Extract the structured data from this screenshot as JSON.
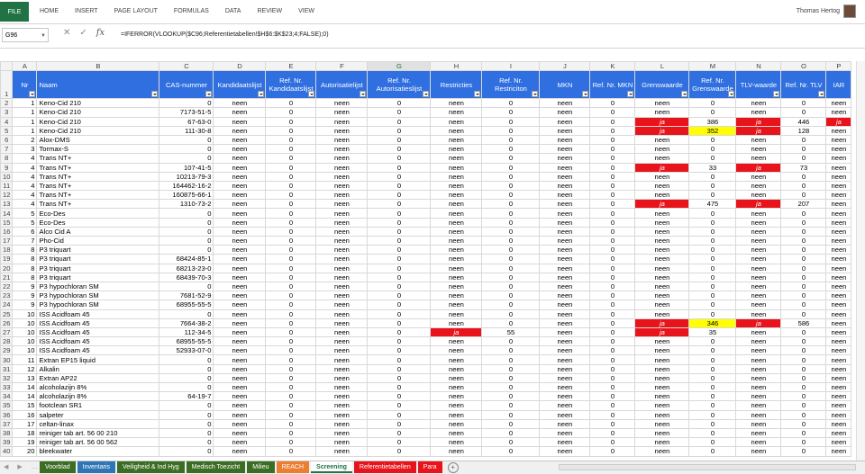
{
  "ribbon": {
    "file_label": "FILE",
    "tabs": [
      "HOME",
      "INSERT",
      "PAGE LAYOUT",
      "FORMULAS",
      "DATA",
      "REVIEW",
      "VIEW"
    ],
    "user_name": "Thomas Hertog"
  },
  "formula_bar": {
    "name_box": "G96",
    "formula": "=IFERROR(VLOOKUP($C96;Referentietabellen!$H$6:$K$23;4;FALSE);0)"
  },
  "columns": [
    "A",
    "B",
    "C",
    "D",
    "E",
    "F",
    "G",
    "H",
    "I",
    "J",
    "K",
    "L",
    "M",
    "N",
    "O",
    "P"
  ],
  "selected_column": "G",
  "headers": [
    "Nr",
    "Naam",
    "CAS-nummer",
    "Kandidaatslijst",
    "Ref. Nr. Kandidaatslijst",
    "Autorisatielijst",
    "Ref. Nr. Autorisatieslijst",
    "Restricties",
    "Ref. Nr. Restriciton",
    "MKN",
    "Ref. Nr. MKN",
    "Grenswaarde",
    "Ref. Nr. Grenswaarde",
    "TLV-waarde",
    "Ref. Nr. TLV",
    "IAR"
  ],
  "rows": [
    [
      "2",
      "1",
      "Keno-Cid 210",
      "0",
      "neen",
      "0",
      "neen",
      "0",
      "neen",
      "0",
      "neen",
      "0",
      "neen",
      "0",
      "neen",
      "0",
      "neen"
    ],
    [
      "3",
      "1",
      "Keno-Cid 210",
      "7173-51-5",
      "neen",
      "0",
      "neen",
      "0",
      "neen",
      "0",
      "neen",
      "0",
      "neen",
      "0",
      "neen",
      "0",
      "neen"
    ],
    [
      "4",
      "1",
      "Keno-Cid 210",
      "67-63-0",
      "neen",
      "0",
      "neen",
      "0",
      "neen",
      "0",
      "neen",
      "0",
      "ja",
      "386",
      "ja",
      "446",
      "ja"
    ],
    [
      "5",
      "1",
      "Keno-Cid 210",
      "111-30-8",
      "neen",
      "0",
      "neen",
      "0",
      "neen",
      "0",
      "neen",
      "0",
      "ja",
      "352",
      "ja",
      "128",
      "neen"
    ],
    [
      "6",
      "2",
      "Alox-DMS",
      "0",
      "neen",
      "0",
      "neen",
      "0",
      "neen",
      "0",
      "neen",
      "0",
      "neen",
      "0",
      "neen",
      "0",
      "neen"
    ],
    [
      "7",
      "3",
      "Tormax-S",
      "0",
      "neen",
      "0",
      "neen",
      "0",
      "neen",
      "0",
      "neen",
      "0",
      "neen",
      "0",
      "neen",
      "0",
      "neen"
    ],
    [
      "8",
      "4",
      "Trans NT+",
      "0",
      "neen",
      "0",
      "neen",
      "0",
      "neen",
      "0",
      "neen",
      "0",
      "neen",
      "0",
      "neen",
      "0",
      "neen"
    ],
    [
      "9",
      "4",
      "Trans NT+",
      "107-41-5",
      "neen",
      "0",
      "neen",
      "0",
      "neen",
      "0",
      "neen",
      "0",
      "ja",
      "33",
      "ja",
      "73",
      "neen"
    ],
    [
      "10",
      "4",
      "Trans NT+",
      "10213-79-3",
      "neen",
      "0",
      "neen",
      "0",
      "neen",
      "0",
      "neen",
      "0",
      "neen",
      "0",
      "neen",
      "0",
      "neen"
    ],
    [
      "11",
      "4",
      "Trans NT+",
      "164462-16-2",
      "neen",
      "0",
      "neen",
      "0",
      "neen",
      "0",
      "neen",
      "0",
      "neen",
      "0",
      "neen",
      "0",
      "neen"
    ],
    [
      "12",
      "4",
      "Trans NT+",
      "160875-66-1",
      "neen",
      "0",
      "neen",
      "0",
      "neen",
      "0",
      "neen",
      "0",
      "neen",
      "0",
      "neen",
      "0",
      "neen"
    ],
    [
      "13",
      "4",
      "Trans NT+",
      "1310-73-2",
      "neen",
      "0",
      "neen",
      "0",
      "neen",
      "0",
      "neen",
      "0",
      "ja",
      "475",
      "ja",
      "207",
      "neen"
    ],
    [
      "14",
      "5",
      "Eco-Des",
      "0",
      "neen",
      "0",
      "neen",
      "0",
      "neen",
      "0",
      "neen",
      "0",
      "neen",
      "0",
      "neen",
      "0",
      "neen"
    ],
    [
      "15",
      "5",
      "Eco-Des",
      "0",
      "neen",
      "0",
      "neen",
      "0",
      "neen",
      "0",
      "neen",
      "0",
      "neen",
      "0",
      "neen",
      "0",
      "neen"
    ],
    [
      "16",
      "6",
      "Alco Cid A",
      "0",
      "neen",
      "0",
      "neen",
      "0",
      "neen",
      "0",
      "neen",
      "0",
      "neen",
      "0",
      "neen",
      "0",
      "neen"
    ],
    [
      "17",
      "7",
      "Pho-Cid",
      "0",
      "neen",
      "0",
      "neen",
      "0",
      "neen",
      "0",
      "neen",
      "0",
      "neen",
      "0",
      "neen",
      "0",
      "neen"
    ],
    [
      "18",
      "8",
      "P3 triquart",
      "0",
      "neen",
      "0",
      "neen",
      "0",
      "neen",
      "0",
      "neen",
      "0",
      "neen",
      "0",
      "neen",
      "0",
      "neen"
    ],
    [
      "19",
      "8",
      "P3 triquart",
      "68424-85-1",
      "neen",
      "0",
      "neen",
      "0",
      "neen",
      "0",
      "neen",
      "0",
      "neen",
      "0",
      "neen",
      "0",
      "neen"
    ],
    [
      "20",
      "8",
      "P3 triquart",
      "68213-23-0",
      "neen",
      "0",
      "neen",
      "0",
      "neen",
      "0",
      "neen",
      "0",
      "neen",
      "0",
      "neen",
      "0",
      "neen"
    ],
    [
      "21",
      "8",
      "P3 triquart",
      "68439-70-3",
      "neen",
      "0",
      "neen",
      "0",
      "neen",
      "0",
      "neen",
      "0",
      "neen",
      "0",
      "neen",
      "0",
      "neen"
    ],
    [
      "22",
      "9",
      "P3 hypochloran SM",
      "0",
      "neen",
      "0",
      "neen",
      "0",
      "neen",
      "0",
      "neen",
      "0",
      "neen",
      "0",
      "neen",
      "0",
      "neen"
    ],
    [
      "23",
      "9",
      "P3 hypochloran SM",
      "7681-52-9",
      "neen",
      "0",
      "neen",
      "0",
      "neen",
      "0",
      "neen",
      "0",
      "neen",
      "0",
      "neen",
      "0",
      "neen"
    ],
    [
      "24",
      "9",
      "P3 hypochloran SM",
      "68955-55-5",
      "neen",
      "0",
      "neen",
      "0",
      "neen",
      "0",
      "neen",
      "0",
      "neen",
      "0",
      "neen",
      "0",
      "neen"
    ],
    [
      "25",
      "10",
      "ISS Acidfoam 45",
      "0",
      "neen",
      "0",
      "neen",
      "0",
      "neen",
      "0",
      "neen",
      "0",
      "neen",
      "0",
      "neen",
      "0",
      "neen"
    ],
    [
      "26",
      "10",
      "ISS Acidfoam 45",
      "7664-38-2",
      "neen",
      "0",
      "neen",
      "0",
      "neen",
      "0",
      "neen",
      "0",
      "ja",
      "346",
      "ja",
      "586",
      "neen"
    ],
    [
      "27",
      "10",
      "ISS Acidfoam 45",
      "112-34-5",
      "neen",
      "0",
      "neen",
      "0",
      "ja",
      "55",
      "neen",
      "0",
      "ja",
      "35",
      "neen",
      "0",
      "neen"
    ],
    [
      "28",
      "10",
      "ISS Acidfoam 45",
      "68955-55-5",
      "neen",
      "0",
      "neen",
      "0",
      "neen",
      "0",
      "neen",
      "0",
      "neen",
      "0",
      "neen",
      "0",
      "neen"
    ],
    [
      "29",
      "10",
      "ISS Acidfoam 45",
      "52933-07-0",
      "neen",
      "0",
      "neen",
      "0",
      "neen",
      "0",
      "neen",
      "0",
      "neen",
      "0",
      "neen",
      "0",
      "neen"
    ],
    [
      "30",
      "11",
      "Extran EP15 liquid",
      "0",
      "neen",
      "0",
      "neen",
      "0",
      "neen",
      "0",
      "neen",
      "0",
      "neen",
      "0",
      "neen",
      "0",
      "neen"
    ],
    [
      "31",
      "12",
      "Alkalin",
      "0",
      "neen",
      "0",
      "neen",
      "0",
      "neen",
      "0",
      "neen",
      "0",
      "neen",
      "0",
      "neen",
      "0",
      "neen"
    ],
    [
      "32",
      "13",
      "Extran AP22",
      "0",
      "neen",
      "0",
      "neen",
      "0",
      "neen",
      "0",
      "neen",
      "0",
      "neen",
      "0",
      "neen",
      "0",
      "neen"
    ],
    [
      "33",
      "14",
      "alcoholazijn 8%",
      "0",
      "neen",
      "0",
      "neen",
      "0",
      "neen",
      "0",
      "neen",
      "0",
      "neen",
      "0",
      "neen",
      "0",
      "neen"
    ],
    [
      "34",
      "14",
      "alcoholazijn 8%",
      "64-19-7",
      "neen",
      "0",
      "neen",
      "0",
      "neen",
      "0",
      "neen",
      "0",
      "neen",
      "0",
      "neen",
      "0",
      "neen"
    ],
    [
      "35",
      "15",
      "footclean SR1",
      "0",
      "neen",
      "0",
      "neen",
      "0",
      "neen",
      "0",
      "neen",
      "0",
      "neen",
      "0",
      "neen",
      "0",
      "neen"
    ],
    [
      "36",
      "16",
      "salpeter",
      "0",
      "neen",
      "0",
      "neen",
      "0",
      "neen",
      "0",
      "neen",
      "0",
      "neen",
      "0",
      "neen",
      "0",
      "neen"
    ],
    [
      "37",
      "17",
      "celtan-linax",
      "0",
      "neen",
      "0",
      "neen",
      "0",
      "neen",
      "0",
      "neen",
      "0",
      "neen",
      "0",
      "neen",
      "0",
      "neen"
    ],
    [
      "38",
      "18",
      "reiniger tab art. 56 00 210",
      "0",
      "neen",
      "0",
      "neen",
      "0",
      "neen",
      "0",
      "neen",
      "0",
      "neen",
      "0",
      "neen",
      "0",
      "neen"
    ],
    [
      "39",
      "19",
      "reiniger tab art. 56 00 562",
      "0",
      "neen",
      "0",
      "neen",
      "0",
      "neen",
      "0",
      "neen",
      "0",
      "neen",
      "0",
      "neen",
      "0",
      "neen"
    ],
    [
      "40",
      "20",
      "bleekwater",
      "0",
      "neen",
      "0",
      "neen",
      "0",
      "neen",
      "0",
      "neen",
      "0",
      "neen",
      "0",
      "neen",
      "0",
      "neen"
    ]
  ],
  "highlight_color_red": "#e8131b",
  "highlight_color_yellow": "#ffff00",
  "yellow_cells": [
    [
      "5",
      "M"
    ],
    [
      "26",
      "M"
    ]
  ],
  "sheet_tabs": [
    {
      "label": "Voorblad",
      "color": "#3b6e22"
    },
    {
      "label": "Inventaris",
      "color": "#2e75b6"
    },
    {
      "label": "Veiligheid & Ind Hyg",
      "color": "#3b6e22"
    },
    {
      "label": "Medisch Toezicht",
      "color": "#3b6e22"
    },
    {
      "label": "Milieu",
      "color": "#3b6e22"
    },
    {
      "label": "REACH",
      "color": "#ed7d31"
    },
    {
      "label": "Screening",
      "color": "#ffffff",
      "active": true
    },
    {
      "label": "Referentietabellen",
      "color": "#e8131b"
    },
    {
      "label": "Para",
      "color": "#e8131b"
    }
  ]
}
